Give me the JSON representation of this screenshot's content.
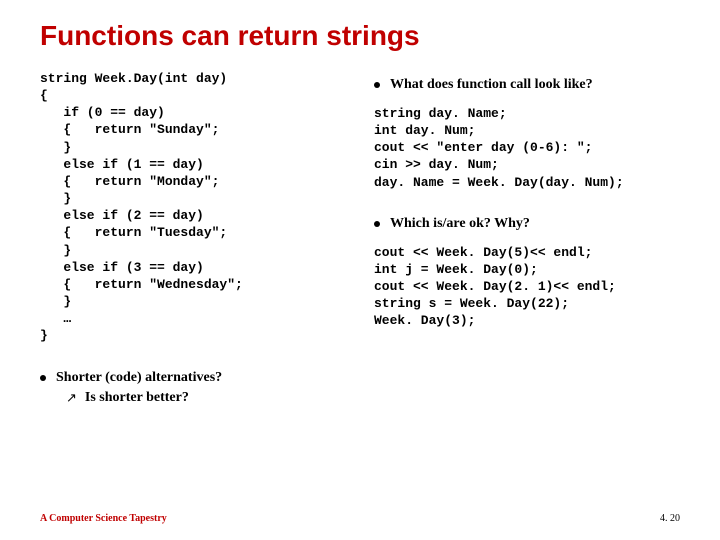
{
  "title": "Functions can return strings",
  "left": {
    "code": "string Week.Day(int day)\n{\n   if (0 == day)\n   {   return \"Sunday\";\n   }\n   else if (1 == day)\n   {   return \"Monday\";\n   }\n   else if (2 == day)\n   {   return \"Tuesday\";\n   }\n   else if (3 == day)\n   {   return \"Wednesday\";\n   }\n   …\n}",
    "bullet": "Shorter (code) alternatives?",
    "sub": "Is shorter better?"
  },
  "right": {
    "q1": "What does function call look like?",
    "code1": "string day. Name;\nint day. Num;\ncout << \"enter day (0-6): \";\ncin >> day. Num;\nday. Name = Week. Day(day. Num);",
    "q2": "Which is/are ok? Why?",
    "code2": "cout << Week. Day(5)<< endl;\nint j = Week. Day(0);\ncout << Week. Day(2. 1)<< endl;\nstring s = Week. Day(22);\nWeek. Day(3);"
  },
  "footer": {
    "left": "A Computer Science Tapestry",
    "right": "4. 20"
  }
}
